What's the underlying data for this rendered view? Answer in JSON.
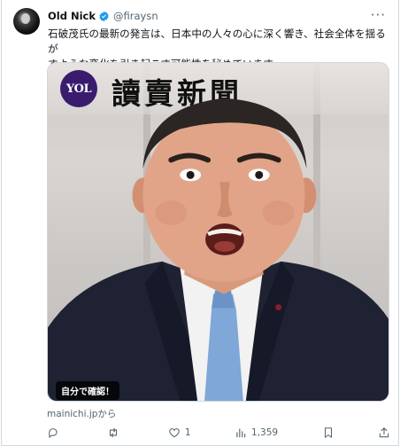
{
  "tweet": {
    "author_name": "Old Nick",
    "author_handle": "@firaysn",
    "more_icon": "more-dots-icon",
    "verified_color": "#1d9bf0",
    "text_line1": "石破茂氏の最新の発言は、日本中の人々の心に深く響き、社会全体を揺るが",
    "text_line2": "すような変化を引き起こす可能性を秘めています。",
    "media": {
      "logo_text": "YOL",
      "masthead": "讀賣新聞",
      "badge": "自分で確認！"
    },
    "source": "mainichi.jpから",
    "actions": {
      "reply_count": "",
      "retweet_count": "",
      "like_count": "1",
      "views_count": "1,359"
    }
  }
}
